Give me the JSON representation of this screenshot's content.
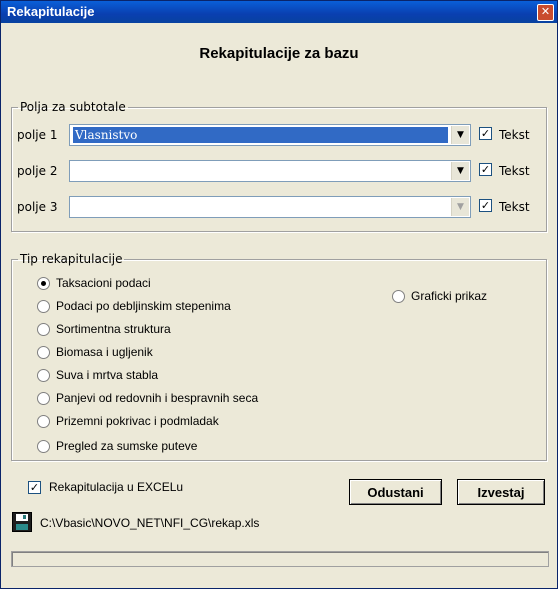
{
  "window": {
    "title": "Rekapitulacije",
    "close_glyph": "✕"
  },
  "heading": "Rekapitulacije za bazu",
  "subtotals": {
    "legend": "Polja za subtotale",
    "rows": [
      {
        "label": "polje 1",
        "value": "Vlasnistvo",
        "checked": true,
        "check_label": "Tekst"
      },
      {
        "label": "polje 2",
        "value": "",
        "checked": true,
        "check_label": "Tekst"
      },
      {
        "label": "polje 3",
        "value": "",
        "checked": true,
        "check_label": "Tekst"
      }
    ]
  },
  "recap_type": {
    "legend": "Tip rekapitulacije",
    "options": [
      "Taksacioni podaci",
      "Podaci po debljinskim stepenima",
      "Sortimentna struktura",
      "Biomasa i ugljenik",
      "Suva i mrtva stabla",
      "Panjevi od redovnih i bespravnih seca",
      "Prizemni pokrivac i podmladak",
      "Pregled za sumske puteve"
    ],
    "selected_index": 0,
    "right_option": "Graficki prikaz"
  },
  "excel_checkbox": {
    "label": "Rekapitulacija u EXCELu",
    "checked": true
  },
  "buttons": {
    "cancel": "Odustani",
    "report": "Izvestaj"
  },
  "file_path": "C:\\Vbasic\\NOVO_NET\\NFI_CG\\rekap.xls",
  "icons": {
    "save": "floppy-disk-icon"
  }
}
